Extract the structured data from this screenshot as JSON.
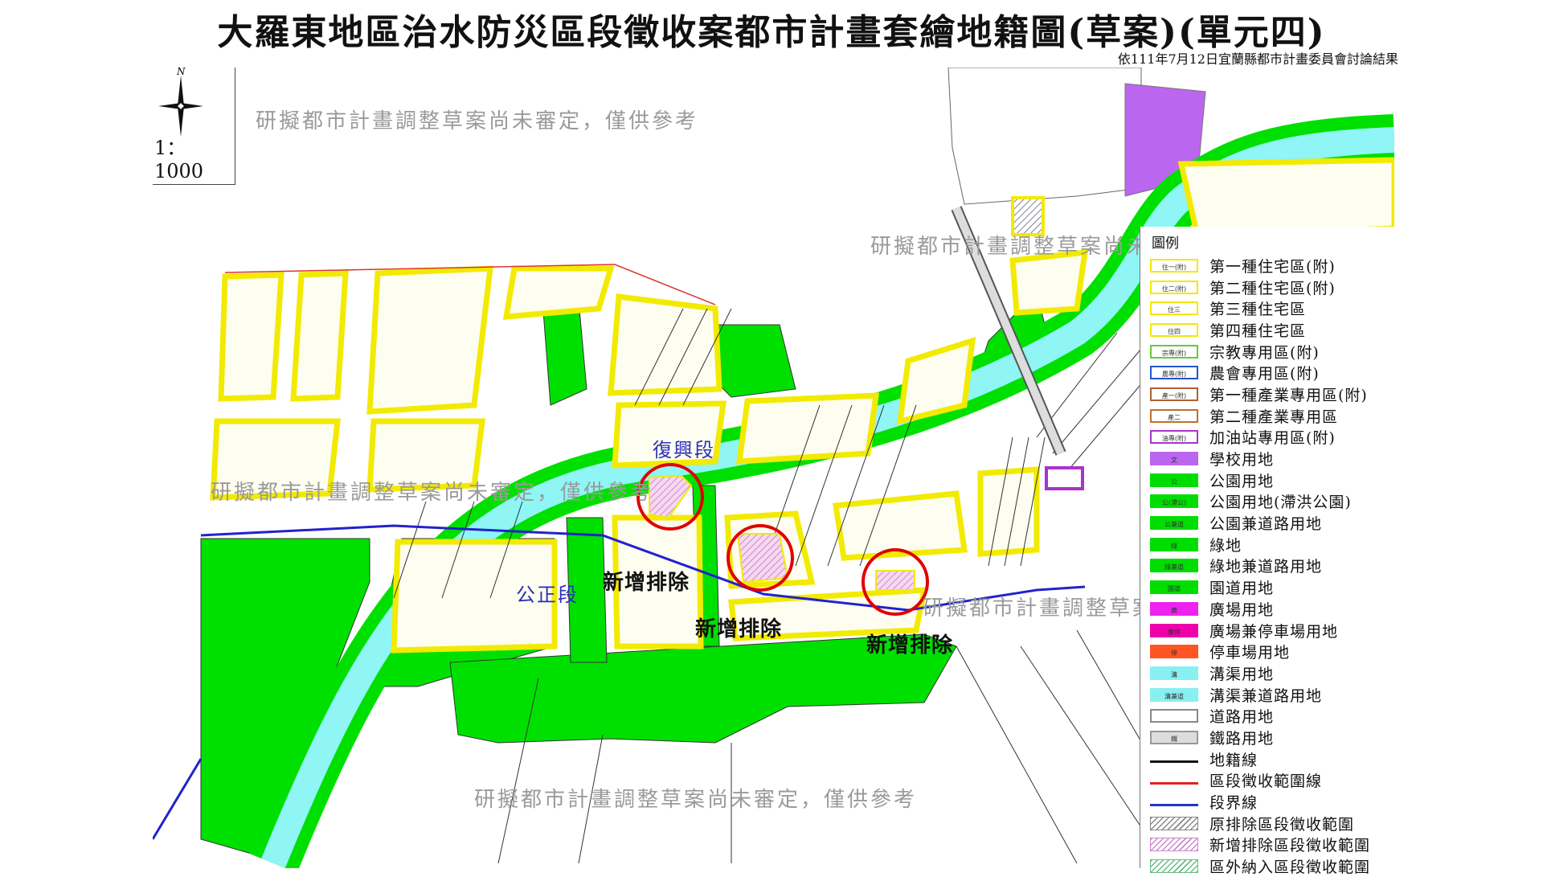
{
  "title": "大羅東地區治水防災區段徵收案都市計畫套繪地籍圖(草案)(單元四)",
  "subtitle": "依111年7月12日宜蘭縣都市計畫委員會討論結果",
  "compass": {
    "north": "N",
    "scale": "1：1000"
  },
  "watermark": "研擬都市計畫調整草案尚未審定，僅供參考",
  "segments": {
    "fuxing": "復興段",
    "gongzheng": "公正段"
  },
  "annotations": {
    "new_exclusion": "新增排除"
  },
  "colors": {
    "residential_fill": "#fdfdf0",
    "residential_border": "#f2ea00",
    "park": "#00e000",
    "canal": "#8ff5f5",
    "school": "#bb66ee",
    "red_circle": "#e00000",
    "boundary_blue": "#2222cc"
  },
  "legend": {
    "heading": "圖例",
    "items": [
      {
        "code": "住一(附)",
        "label": "第一種住宅區(附)",
        "fill": "#ffffff",
        "border": "#f2ea00"
      },
      {
        "code": "住二(附)",
        "label": "第二種住宅區(附)",
        "fill": "#ffffff",
        "border": "#f2ea00"
      },
      {
        "code": "住三",
        "label": "第三種住宅區",
        "fill": "#ffffff",
        "border": "#f2ea00"
      },
      {
        "code": "住四",
        "label": "第四種住宅區",
        "fill": "#ffffff",
        "border": "#f2ea00"
      },
      {
        "code": "宗專(附)",
        "label": "宗教專用區(附)",
        "fill": "#ffffff",
        "border": "#66cc33"
      },
      {
        "code": "農專(附)",
        "label": "農會專用區(附)",
        "fill": "#ffffff",
        "border": "#2255cc"
      },
      {
        "code": "產一(附)",
        "label": "第一種產業專用區(附)",
        "fill": "#ffffff",
        "border": "#b06030"
      },
      {
        "code": "產二",
        "label": "第二種產業專用區",
        "fill": "#ffffff",
        "border": "#c07030"
      },
      {
        "code": "油專(附)",
        "label": "加油站專用區(附)",
        "fill": "#ffffff",
        "border": "#aa33cc"
      },
      {
        "code": "文",
        "label": "學校用地",
        "fill": "#bb66ee",
        "border": "#bb66ee"
      },
      {
        "code": "公",
        "label": "公園用地",
        "fill": "#00dd00",
        "border": "#00dd00"
      },
      {
        "code": "公(滯公)",
        "label": "公園用地(滯洪公園)",
        "fill": "#00dd00",
        "border": "#00dd00"
      },
      {
        "code": "公兼道",
        "label": "公園兼道路用地",
        "fill": "#00dd00",
        "border": "#00dd00"
      },
      {
        "code": "綠",
        "label": "綠地",
        "fill": "#00dd00",
        "border": "#00dd00"
      },
      {
        "code": "綠兼道",
        "label": "綠地兼道路用地",
        "fill": "#00dd00",
        "border": "#00dd00"
      },
      {
        "code": "園道",
        "label": "園道用地",
        "fill": "#00dd00",
        "border": "#00dd00"
      },
      {
        "code": "廣",
        "label": "廣場用地",
        "fill": "#ee22ee",
        "border": "#ee22ee"
      },
      {
        "code": "廣停",
        "label": "廣場兼停車場用地",
        "fill": "#ee00aa",
        "border": "#ee00aa"
      },
      {
        "code": "停",
        "label": "停車場用地",
        "fill": "#ff5522",
        "border": "#ff5522"
      },
      {
        "code": "溝",
        "label": "溝渠用地",
        "fill": "#88f0f0",
        "border": "#88f0f0"
      },
      {
        "code": "溝兼道",
        "label": "溝渠兼道路用地",
        "fill": "#88f0f0",
        "border": "#88f0f0"
      },
      {
        "code": "",
        "label": "道路用地",
        "fill": "#ffffff",
        "border": "#888888"
      },
      {
        "code": "鐵",
        "label": "鐵路用地",
        "fill": "#dddddd",
        "border": "#999999"
      },
      {
        "code": "",
        "label": "地籍線",
        "fill": "line-black",
        "border": "#111111"
      },
      {
        "code": "",
        "label": "區段徵收範圍線",
        "fill": "line-red",
        "border": "#dd2222"
      },
      {
        "code": "",
        "label": "段界線",
        "fill": "line-blue",
        "border": "#2233cc"
      },
      {
        "code": "",
        "label": "原排除區段徵收範圍",
        "fill": "hatch-gray",
        "border": "#888888"
      },
      {
        "code": "",
        "label": "新增排除區段徵收範圍",
        "fill": "hatch-pink",
        "border": "#cc88cc"
      },
      {
        "code": "",
        "label": "區外納入區段徵收範圍",
        "fill": "hatch-green",
        "border": "#66bb88"
      }
    ]
  }
}
